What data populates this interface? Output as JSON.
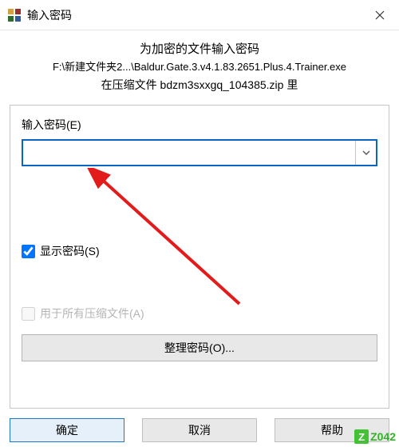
{
  "titlebar": {
    "title": "输入密码"
  },
  "header": {
    "line1": "为加密的文件输入密码",
    "line2": "F:\\新建文件夹2...\\Baldur.Gate.3.v4.1.83.2651.Plus.4.Trainer.exe",
    "line3": "在压缩文件 bdzm3sxxgq_104385.zip 里"
  },
  "form": {
    "password_label": "输入密码(E)",
    "password_value": "",
    "show_password_label": "显示密码(S)",
    "show_password_checked": true,
    "apply_all_label": "用于所有压缩文件(A)",
    "apply_all_checked": false,
    "organize_button": "整理密码(O)..."
  },
  "buttons": {
    "ok": "确定",
    "cancel": "取消",
    "help": "帮助"
  },
  "watermark": {
    "text": "Z042"
  }
}
